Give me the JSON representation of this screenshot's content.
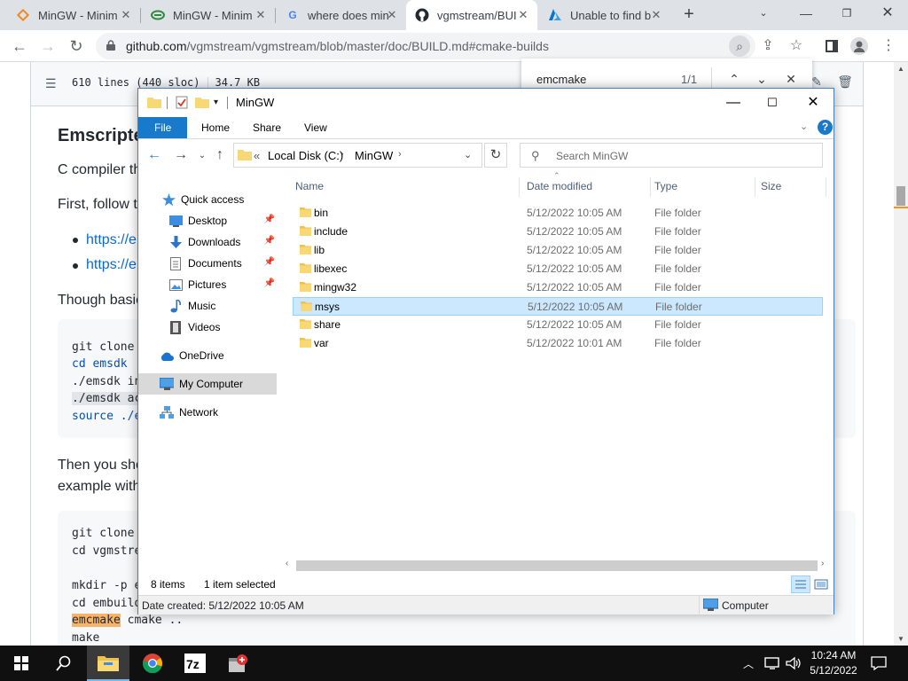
{
  "browser": {
    "tabs": [
      {
        "title": "MinGW - Minim",
        "favicon": "mingw-diamond-icon",
        "color": "#f08a24"
      },
      {
        "title": "MinGW - Minim",
        "favicon": "sourceforge-icon",
        "color": "#2f8a3c"
      },
      {
        "title": "where does min",
        "favicon": "google-icon",
        "color": "#4285f4"
      },
      {
        "title": "vgmstream/BUI",
        "favicon": "github-icon",
        "color": "#24292f",
        "active": true
      },
      {
        "title": "Unable to find b",
        "favicon": "azure-icon",
        "color": "#0078d4"
      }
    ],
    "url_host": "github.com",
    "url_path": "/vgmstream/vgmstream/blob/master/doc/BUILD.md#cmake-builds",
    "find": {
      "query": "emcmake",
      "count": "1/1"
    }
  },
  "github": {
    "file_info": {
      "lines": "610 lines (440 sloc)",
      "size": "34.7 KB"
    },
    "heading": "Emscripte",
    "para1": "C compiler th",
    "para2": "First, follow t",
    "links": [
      "https://e",
      "https://e"
    ],
    "para3": "Though basic",
    "code1": [
      {
        "text": "git clone ",
        "kind": "plain"
      },
      {
        "text": "cd emsdk",
        "kind": "kw"
      },
      {
        "text": "./emsdk in",
        "kind": "plain"
      },
      {
        "text": "./emsdk ac",
        "kind": "sel"
      },
      {
        "text": "source ./e",
        "kind": "kw"
      }
    ],
    "para4a": "Then you sho",
    "para4b": "example with",
    "code2": [
      {
        "text": "git clone "
      },
      {
        "text": "cd vgmstre"
      },
      {
        "text": ""
      },
      {
        "text": "mkdir -p e"
      },
      {
        "text": "cd embuild"
      }
    ],
    "code2_hl": "emcmake",
    "code2_hl_rest": " cmake ..",
    "code2_last": "make"
  },
  "explorer": {
    "title": "MinGW",
    "ribbon_tabs": [
      "File",
      "Home",
      "Share",
      "View"
    ],
    "address": {
      "prefix": "«",
      "parts": [
        "Local Disk (C:)",
        "MinGW"
      ]
    },
    "search_placeholder": "Search MinGW",
    "nav": [
      {
        "label": "Quick access",
        "icon": "star-icon",
        "pinned": false
      },
      {
        "label": "Desktop",
        "icon": "desktop-icon",
        "pinned": true
      },
      {
        "label": "Downloads",
        "icon": "download-icon",
        "pinned": true
      },
      {
        "label": "Documents",
        "icon": "documents-icon",
        "pinned": true
      },
      {
        "label": "Pictures",
        "icon": "pictures-icon",
        "pinned": true
      },
      {
        "label": "Music",
        "icon": "music-icon",
        "pinned": false
      },
      {
        "label": "Videos",
        "icon": "videos-icon",
        "pinned": false
      },
      {
        "label": "OneDrive",
        "icon": "cloud-icon",
        "pinned": false
      },
      {
        "label": "My Computer",
        "icon": "computer-icon",
        "pinned": false,
        "selected": true
      },
      {
        "label": "Network",
        "icon": "network-icon",
        "pinned": false
      }
    ],
    "columns": [
      "Name",
      "Date modified",
      "Type",
      "Size"
    ],
    "files": [
      {
        "name": "bin",
        "date": "5/12/2022 10:05 AM",
        "type": "File folder"
      },
      {
        "name": "include",
        "date": "5/12/2022 10:05 AM",
        "type": "File folder"
      },
      {
        "name": "lib",
        "date": "5/12/2022 10:05 AM",
        "type": "File folder"
      },
      {
        "name": "libexec",
        "date": "5/12/2022 10:05 AM",
        "type": "File folder"
      },
      {
        "name": "mingw32",
        "date": "5/12/2022 10:05 AM",
        "type": "File folder"
      },
      {
        "name": "msys",
        "date": "5/12/2022 10:05 AM",
        "type": "File folder",
        "selected": true
      },
      {
        "name": "share",
        "date": "5/12/2022 10:05 AM",
        "type": "File folder"
      },
      {
        "name": "var",
        "date": "5/12/2022 10:01 AM",
        "type": "File folder"
      }
    ],
    "status": {
      "items": "8 items",
      "selected": "1 item selected"
    },
    "details": {
      "created": "Date created: 5/12/2022 10:05 AM",
      "location": "Computer"
    }
  },
  "taskbar": {
    "apps": [
      "file-explorer-icon",
      "chrome-icon",
      "7zip-icon",
      "installer-icon"
    ],
    "time": "10:24 AM",
    "date": "5/12/2022"
  },
  "colors": {
    "accent": "#1979ca",
    "selection": "#cce8ff",
    "link": "#0969da",
    "highlight": "#f7b468"
  }
}
